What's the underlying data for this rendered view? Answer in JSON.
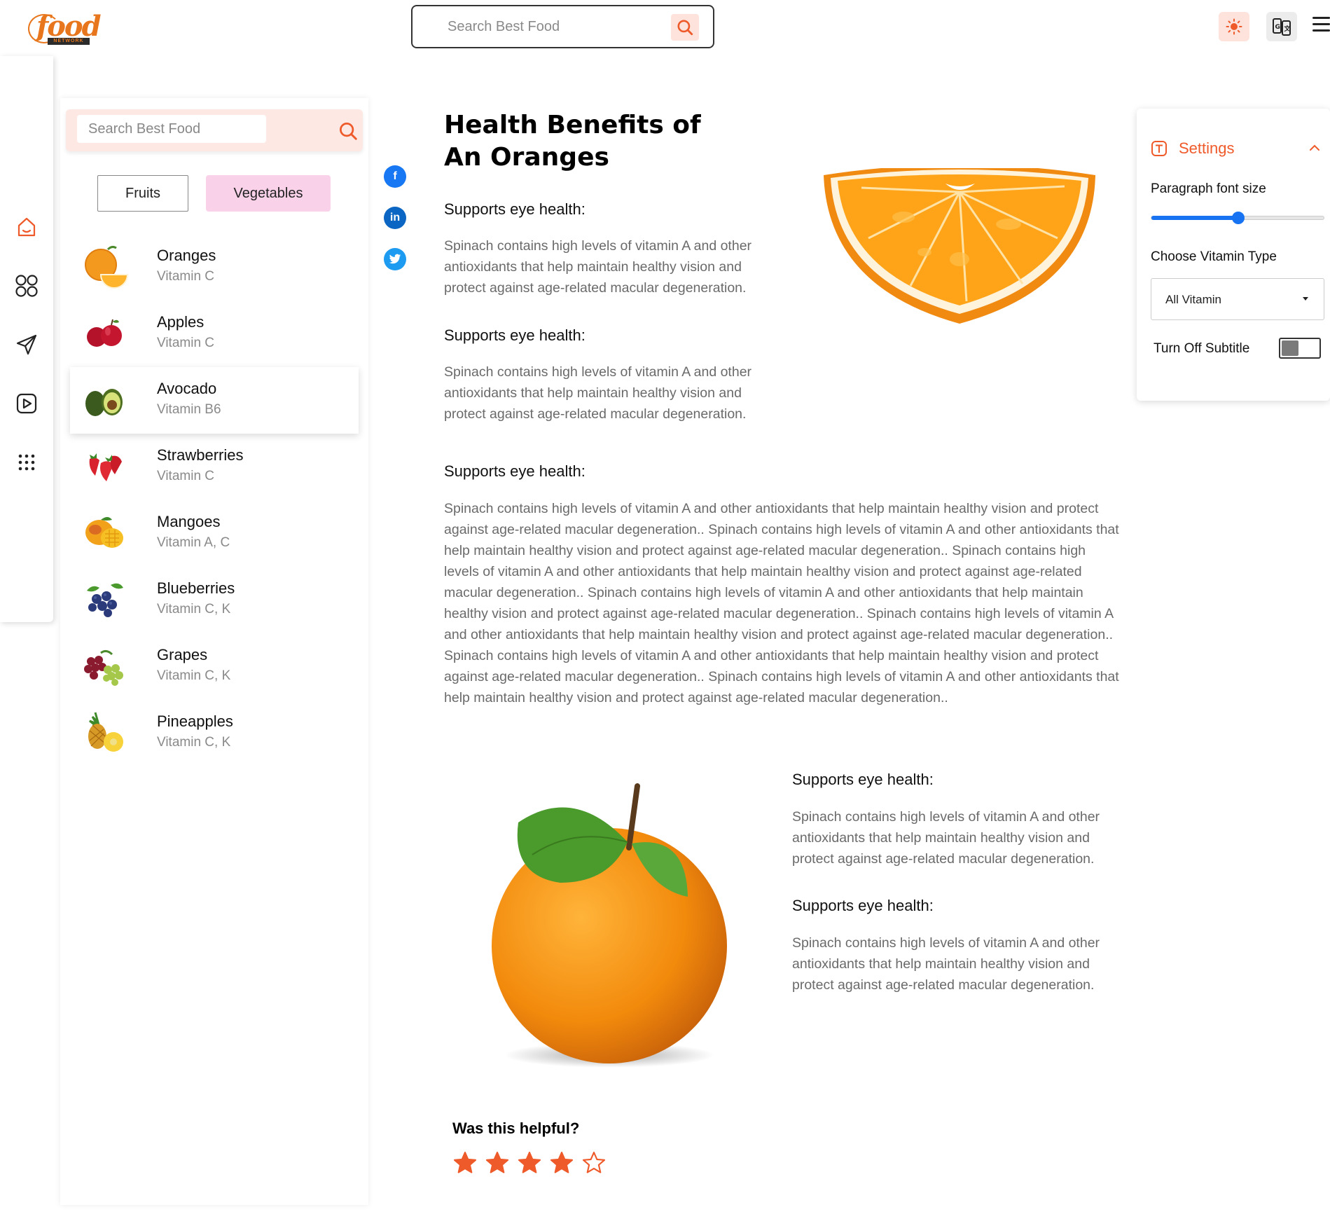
{
  "brand": {
    "logo_text": "food",
    "logo_sub": "NETWORK"
  },
  "header": {
    "search_placeholder": "Search Best Food",
    "accent_color": "#ef5a2a"
  },
  "rail": {
    "items": [
      {
        "icon": "home-icon"
      },
      {
        "icon": "categories-icon"
      },
      {
        "icon": "send-icon"
      },
      {
        "icon": "video-icon"
      },
      {
        "icon": "apps-grid-icon"
      }
    ]
  },
  "sidebar": {
    "search_placeholder": "Search Best Food",
    "tabs": [
      {
        "label": "Fruits",
        "active": false
      },
      {
        "label": "Vegetables",
        "active": true
      }
    ],
    "items": [
      {
        "name": "Oranges",
        "vitamin": "Vitamin C"
      },
      {
        "name": "Apples",
        "vitamin": "Vitamin C"
      },
      {
        "name": "Avocado",
        "vitamin": "Vitamin B6"
      },
      {
        "name": "Strawberries",
        "vitamin": "Vitamin C"
      },
      {
        "name": "Mangoes",
        "vitamin": "Vitamin A, C"
      },
      {
        "name": "Blueberries",
        "vitamin": "Vitamin C, K"
      },
      {
        "name": "Grapes",
        "vitamin": "Vitamin C, K"
      },
      {
        "name": "Pineapples",
        "vitamin": "Vitamin C, K"
      }
    ],
    "active_index": 2
  },
  "article": {
    "title": "Health Benefits of An Oranges",
    "sections": [
      {
        "heading": "Supports eye health:",
        "body": "Spinach contains high levels of vitamin A and other antioxidants that help maintain healthy vision and protect against age-related macular degeneration."
      },
      {
        "heading": "Supports eye health:",
        "body": "Spinach contains high levels of vitamin A and other antioxidants that help maintain healthy vision and protect against age-related macular degeneration."
      },
      {
        "heading": "Supports eye health:",
        "body": "Spinach contains high levels of vitamin A and other antioxidants that help maintain healthy vision and protect against age-related macular degeneration.. Spinach contains high levels of vitamin A and other antioxidants that help maintain healthy vision and protect against age-related macular degeneration.. Spinach contains high levels of vitamin A and other antioxidants that help maintain healthy vision and protect against age-related macular degeneration.. Spinach contains high levels of vitamin A and other antioxidants that help maintain healthy vision and protect against age-related macular degeneration.. Spinach contains high levels of vitamin A and other antioxidants that help maintain healthy vision and protect against age-related macular degeneration.. Spinach contains high levels of vitamin A and other antioxidants that help maintain healthy vision and protect against age-related macular degeneration.. Spinach contains high levels of vitamin A and other antioxidants that help maintain healthy vision and protect against age-related macular degeneration.."
      },
      {
        "heading": "Supports eye health:",
        "body": "Spinach contains high levels of vitamin A and other antioxidants that help maintain healthy vision and protect against age-related macular degeneration."
      },
      {
        "heading": "Supports eye health:",
        "body": "Spinach contains high levels of vitamin A and other antioxidants that help maintain healthy vision and protect against age-related macular degeneration."
      }
    ]
  },
  "social": [
    "facebook-icon",
    "linkedin-icon",
    "twitter-icon"
  ],
  "settings": {
    "title": "Settings",
    "font_size_label": "Paragraph font size",
    "font_size_level": 0.5,
    "vitamin_label": "Choose Vitamin Type",
    "vitamin_selected": "All Vitamin",
    "subtitle_label": "Turn Off Subtitle",
    "subtitle_off": false
  },
  "feedback": {
    "question": "Was this helpful?",
    "rating": 4,
    "max_rating": 5
  }
}
